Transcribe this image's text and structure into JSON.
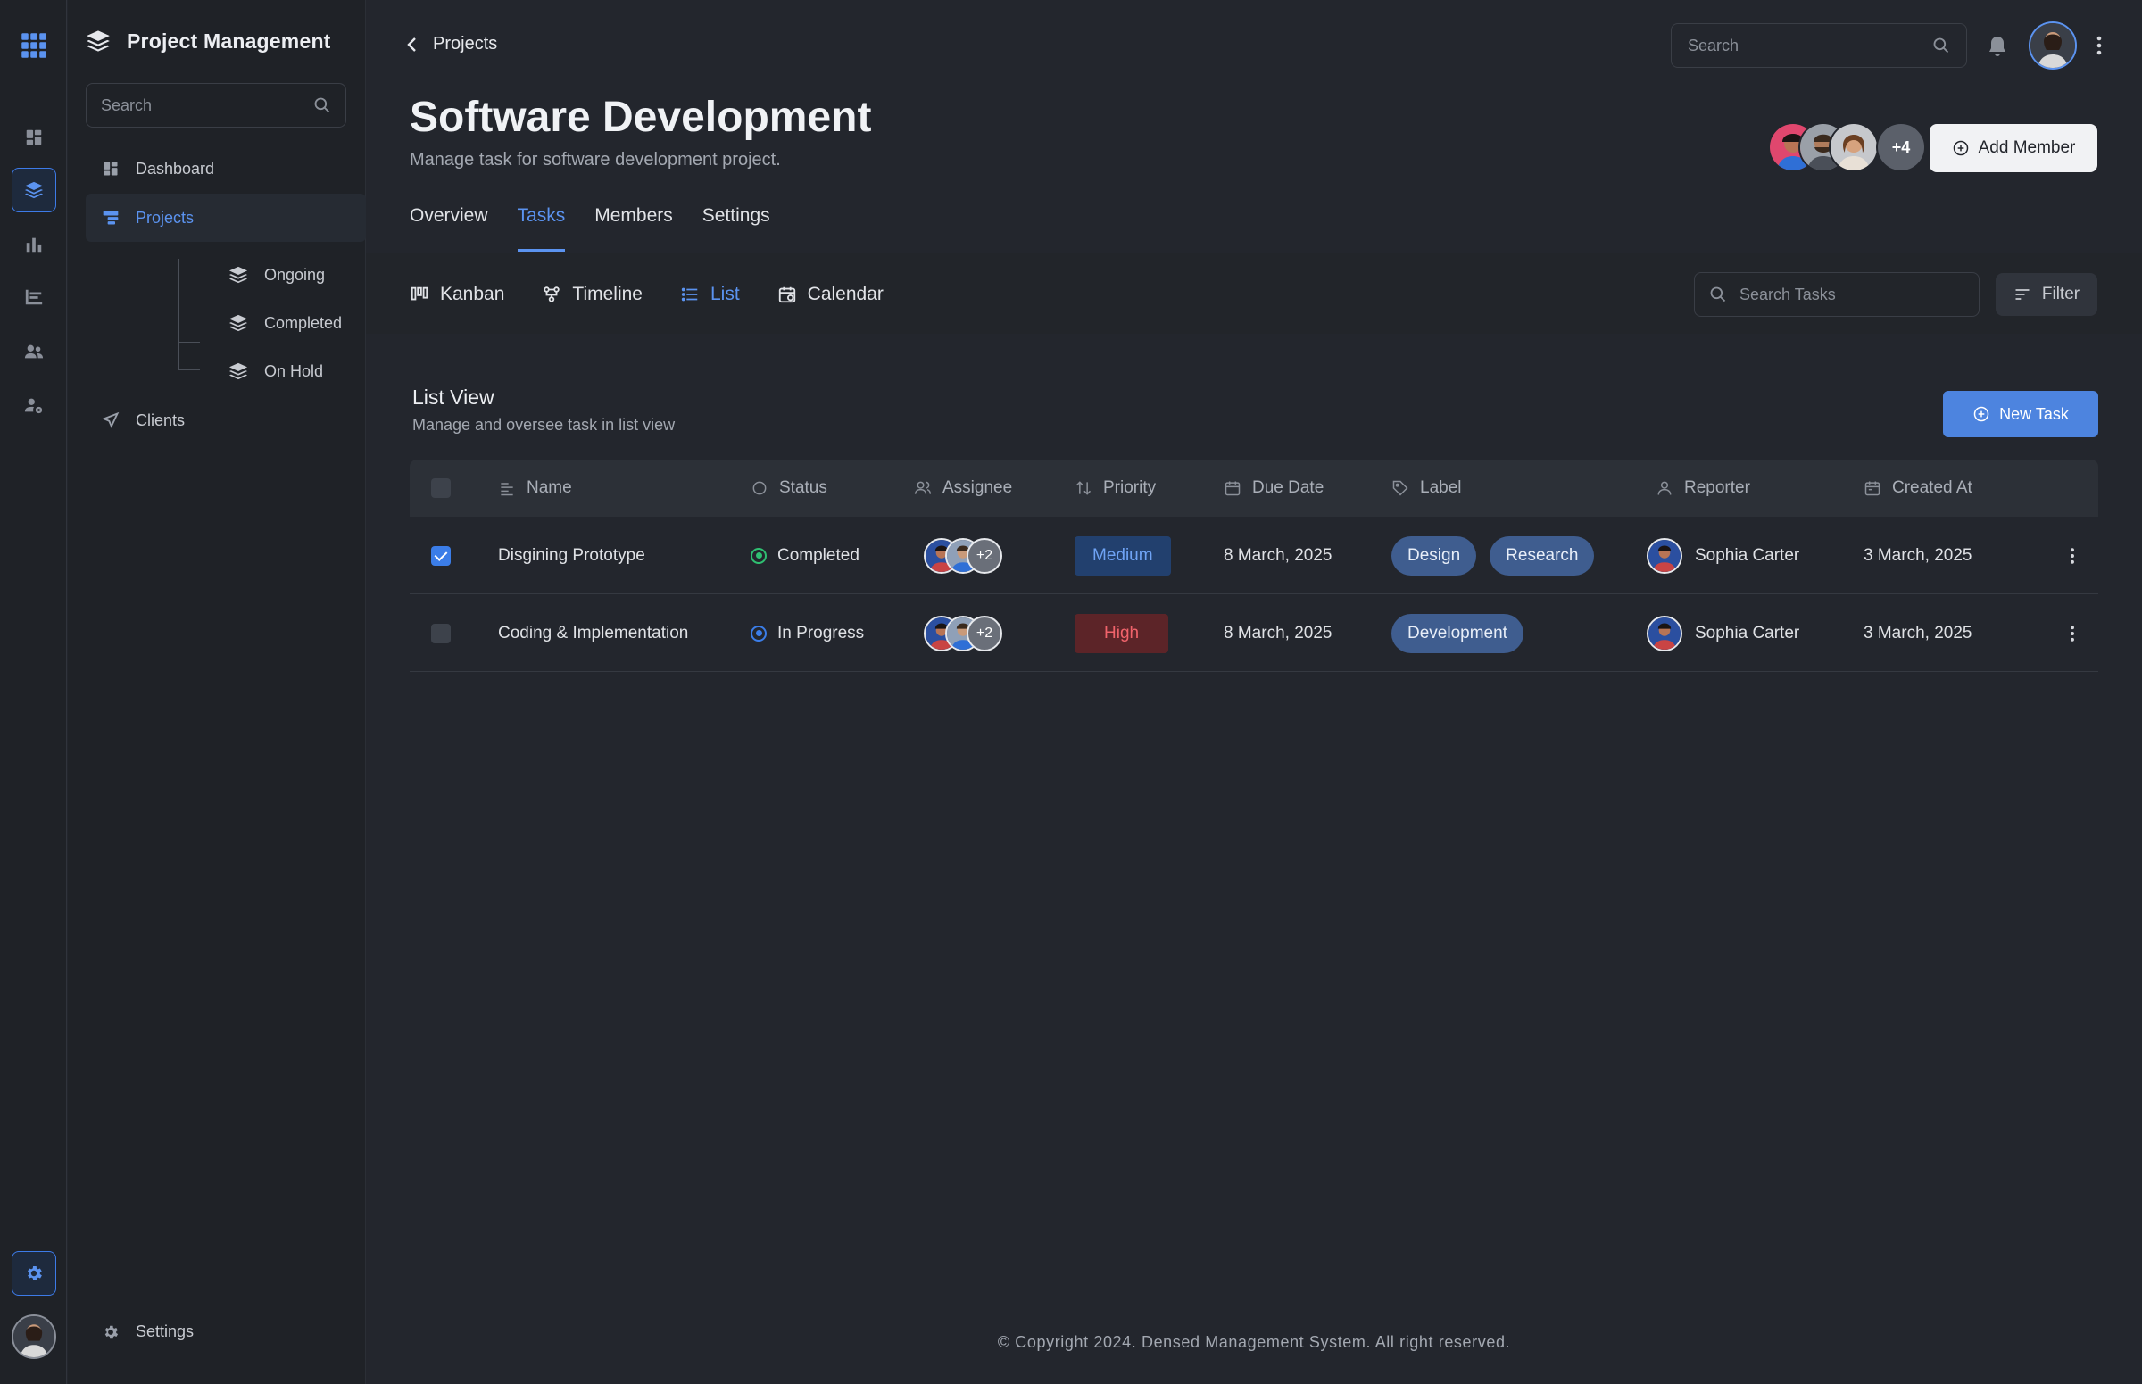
{
  "app": {
    "title": "Project Management",
    "sidebar_search_placeholder": "Search",
    "top_search_placeholder": "Search"
  },
  "sidebar": {
    "items": [
      {
        "label": "Dashboard",
        "icon": "dashboard-icon"
      },
      {
        "label": "Projects",
        "icon": "projects-icon",
        "active": true
      },
      {
        "label": "Clients",
        "icon": "send-icon"
      }
    ],
    "sub_items": [
      {
        "label": "Ongoing",
        "icon": "layers-icon"
      },
      {
        "label": "Completed",
        "icon": "layers-icon"
      },
      {
        "label": "On Hold",
        "icon": "layers-icon"
      }
    ],
    "settings_label": "Settings"
  },
  "header": {
    "breadcrumb": "Projects",
    "title": "Software Development",
    "subtitle": "Manage task for software development project.",
    "members_more": "+4",
    "add_member_label": "Add Member"
  },
  "tabs": [
    "Overview",
    "Tasks",
    "Members",
    "Settings"
  ],
  "active_tab": "Tasks",
  "views": [
    "Kanban",
    "Timeline",
    "List",
    "Calendar"
  ],
  "active_view": "List",
  "toolbar": {
    "search_tasks_placeholder": "Search Tasks",
    "filter_label": "Filter"
  },
  "list": {
    "title": "List View",
    "subtitle": "Manage and oversee task in list view",
    "new_task_label": "New Task",
    "columns": [
      "Name",
      "Status",
      "Assignee",
      "Priority",
      "Due Date",
      "Label",
      "Reporter",
      "Created At"
    ],
    "rows": [
      {
        "checked": true,
        "name": "Disgining Prototype",
        "status": "Completed",
        "status_color": "#2fbf71",
        "assignee_more": "+2",
        "priority": "Medium",
        "due_date": "8 March, 2025",
        "labels": [
          "Design",
          "Research"
        ],
        "reporter": "Sophia Carter",
        "created_at": "3 March, 2025"
      },
      {
        "checked": false,
        "name": "Coding & Implementation",
        "status": "In Progress",
        "status_color": "#3b7de8",
        "assignee_more": "+2",
        "priority": "High",
        "due_date": "8 March, 2025",
        "labels": [
          "Development"
        ],
        "reporter": "Sophia Carter",
        "created_at": "3 March, 2025"
      }
    ]
  },
  "footer": "© Copyright 2024. Densed Management System. All right reserved.",
  "colors": {
    "accent": "#5b93f0",
    "background": "#23262d",
    "sidebar": "#1f2227",
    "priority_medium": "#6fa3f5",
    "priority_high": "#f0636b",
    "tag_bg": "#3f5d8f"
  }
}
